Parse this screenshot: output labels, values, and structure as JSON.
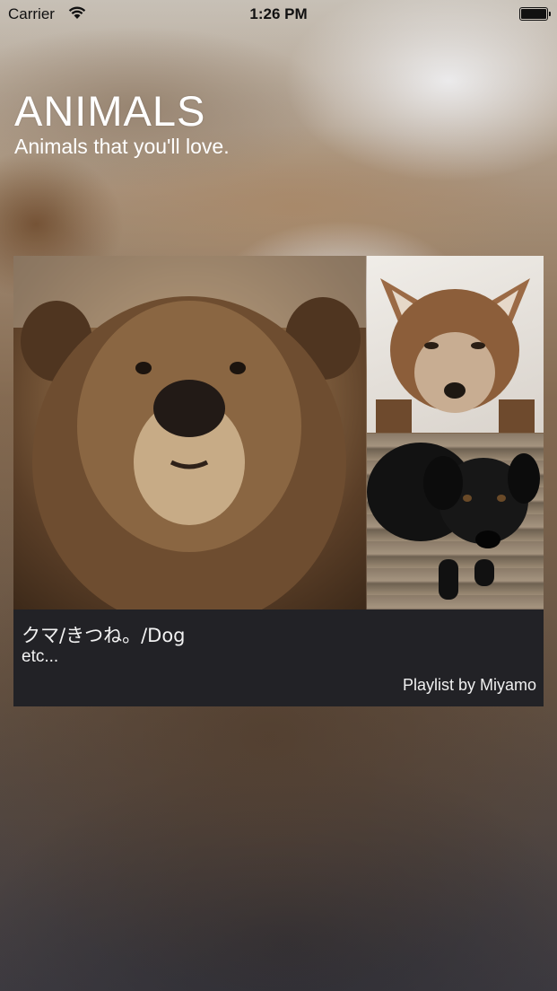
{
  "status_bar": {
    "carrier": "Carrier",
    "time": "1:26 PM"
  },
  "header": {
    "title": "ANIMALS",
    "subtitle": "Animals that you'll love."
  },
  "playlist_card": {
    "title": "クマ/きつね。/Dog",
    "subtitle": "etc...",
    "author_credit": "Playlist by Miyamo",
    "images": [
      "bear-photo",
      "fox-photo",
      "dog-photo"
    ]
  },
  "colors": {
    "panel_background": "#222226",
    "text_light": "#ffffff"
  }
}
